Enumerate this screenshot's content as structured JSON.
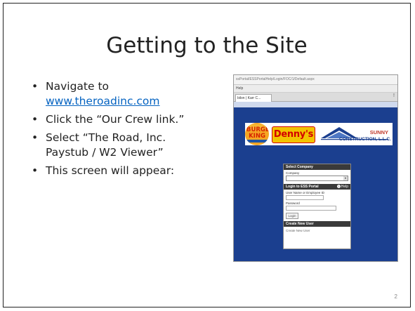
{
  "slide": {
    "title": "Getting to the Site",
    "bullets": {
      "b1_text": "Navigate to",
      "b1_link": "www.theroadinc.com",
      "b2": "Click the “Our Crew link.”",
      "b3_line1": "Select “The Road, Inc.",
      "b3_line2": "Paystub / W2 Viewer”",
      "b4": "This screen will appear:"
    },
    "page_number": "2",
    "link_color": "#0563c1"
  },
  "screenshot": {
    "address_bar": "ssPortal/ESSPortalHelp/Login/FOC/1/Default.aspx",
    "menu": "Help",
    "tab_label": "bilon | Karr C...",
    "tab_warning": "!",
    "logos": {
      "burger_king": "BURGER KING",
      "dennys": "Denny's",
      "sunny": "SUNNY",
      "construction": "CONSTRUCTION, L.L.C."
    },
    "panel": {
      "select_company_header": "Select Company",
      "company_label": "Company",
      "login_header": "Login to ESS Portal",
      "help_label": "Help",
      "username_label": "User Name or Employee ID",
      "password_label": "Password",
      "login_button": "Login",
      "create_header": "Create New User",
      "create_link": "Create New User"
    },
    "background_color": "#1b3f8f"
  }
}
